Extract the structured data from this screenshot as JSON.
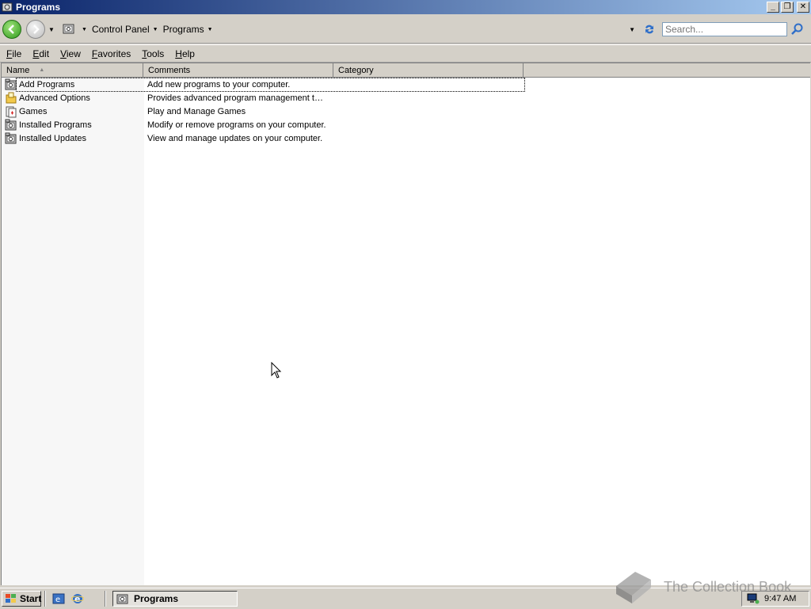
{
  "window": {
    "title": "Programs"
  },
  "navbar": {
    "breadcrumbs": [
      "Control Panel",
      "Programs"
    ],
    "search_placeholder": "Search..."
  },
  "menu": {
    "items": [
      {
        "label": "File",
        "accel": "F",
        "rest": "ile"
      },
      {
        "label": "Edit",
        "accel": "E",
        "rest": "dit"
      },
      {
        "label": "View",
        "accel": "V",
        "rest": "iew"
      },
      {
        "label": "Favorites",
        "accel": "F",
        "rest": "avorites"
      },
      {
        "label": "Tools",
        "accel": "T",
        "rest": "ools"
      },
      {
        "label": "Help",
        "accel": "H",
        "rest": "elp"
      }
    ]
  },
  "list": {
    "columns": [
      "Name",
      "Comments",
      "Category"
    ],
    "rows": [
      {
        "name": "Add Programs",
        "comment": "Add new programs to your computer.",
        "icon": "programs-icon"
      },
      {
        "name": "Advanced Options",
        "comment": "Provides advanced program management tas...",
        "icon": "folder-icon"
      },
      {
        "name": "Games",
        "comment": "Play and Manage Games",
        "icon": "games-icon"
      },
      {
        "name": "Installed Programs",
        "comment": "Modify or remove programs on your computer.",
        "icon": "programs-icon"
      },
      {
        "name": "Installed Updates",
        "comment": "View and manage updates on your computer.",
        "icon": "programs-icon"
      }
    ]
  },
  "taskbar": {
    "start_label": "Start",
    "task_label": "Programs",
    "clock": "9:47 AM"
  },
  "watermark": {
    "text": "The Collection Book"
  },
  "colors": {
    "titlebar_start": "#0a246a",
    "titlebar_end": "#a6caf0",
    "chrome": "#d4d0c8"
  }
}
